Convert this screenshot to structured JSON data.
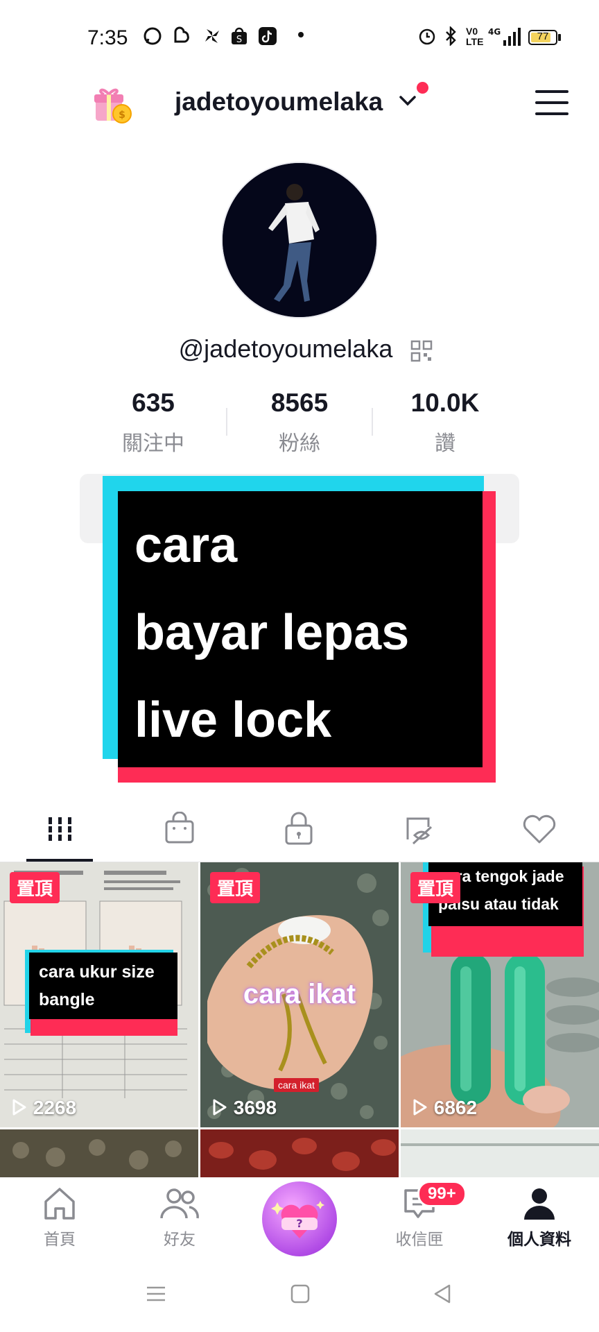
{
  "status_bar": {
    "time": "7:35",
    "battery": "77",
    "network": "4G"
  },
  "header": {
    "username": "jadetoyoumelaka",
    "has_notification": true
  },
  "profile": {
    "handle": "@jadetoyoumelaka"
  },
  "stats": [
    {
      "value": "635",
      "label": "關注中"
    },
    {
      "value": "8565",
      "label": "粉絲"
    },
    {
      "value": "10.0K",
      "label": "讚"
    }
  ],
  "overlay": {
    "lines": [
      "cara",
      "bayar lepas",
      "live lock"
    ]
  },
  "tabs": [
    "videos",
    "shop",
    "private",
    "reposts",
    "liked"
  ],
  "videos": [
    {
      "pinned": "置頂",
      "caption": "cara ukur size bangle",
      "views": "2268"
    },
    {
      "pinned": "置頂",
      "caption": "cara ikat",
      "sub_caption": "cara ikat",
      "views": "3698"
    },
    {
      "pinned": "置頂",
      "caption": "cara tengok jade palsu atau tidak",
      "views": "6862"
    }
  ],
  "bottom_nav": {
    "home": "首頁",
    "friends": "好友",
    "inbox": "收信匣",
    "inbox_badge": "99+",
    "profile": "個人資料"
  },
  "colors": {
    "accent_red": "#fe2c55",
    "accent_cyan": "#20d5ec",
    "text_primary": "#161823",
    "text_secondary": "#8a8b91"
  }
}
